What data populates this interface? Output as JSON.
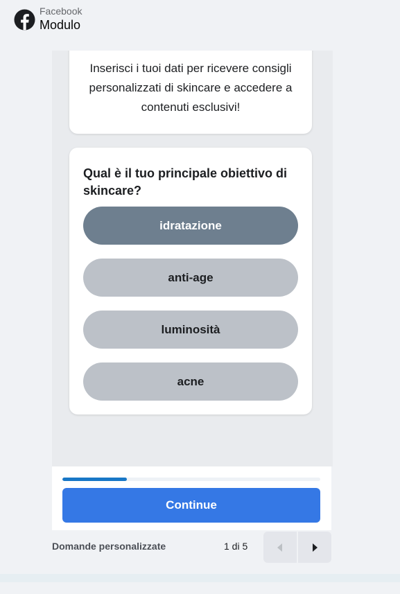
{
  "header": {
    "platform": "Facebook",
    "title": "Modulo",
    "logo_icon": "facebook-logo-icon"
  },
  "intro": {
    "text": "Inserisci i tuoi dati per ricevere consigli personalizzati di skincare e accedere a contenuti esclusivi!"
  },
  "question": {
    "title": "Qual è il tuo principale obiettivo di skincare?",
    "options": [
      {
        "label": "idratazione",
        "selected": true
      },
      {
        "label": "anti-age",
        "selected": false
      },
      {
        "label": "luminosità",
        "selected": false
      },
      {
        "label": "acne",
        "selected": false
      }
    ]
  },
  "progress": {
    "fraction": 0.25
  },
  "continue_label": "Continue",
  "footer": {
    "section_label": "Domande personalizzate",
    "page_indicator": "1 di 5",
    "prev_icon": "caret-left-icon",
    "next_icon": "caret-right-icon"
  },
  "colors": {
    "accent": "#3578e5",
    "progress": "#1877c6",
    "selected_option": "#6e7f8f",
    "option": "#bcc1c8"
  }
}
